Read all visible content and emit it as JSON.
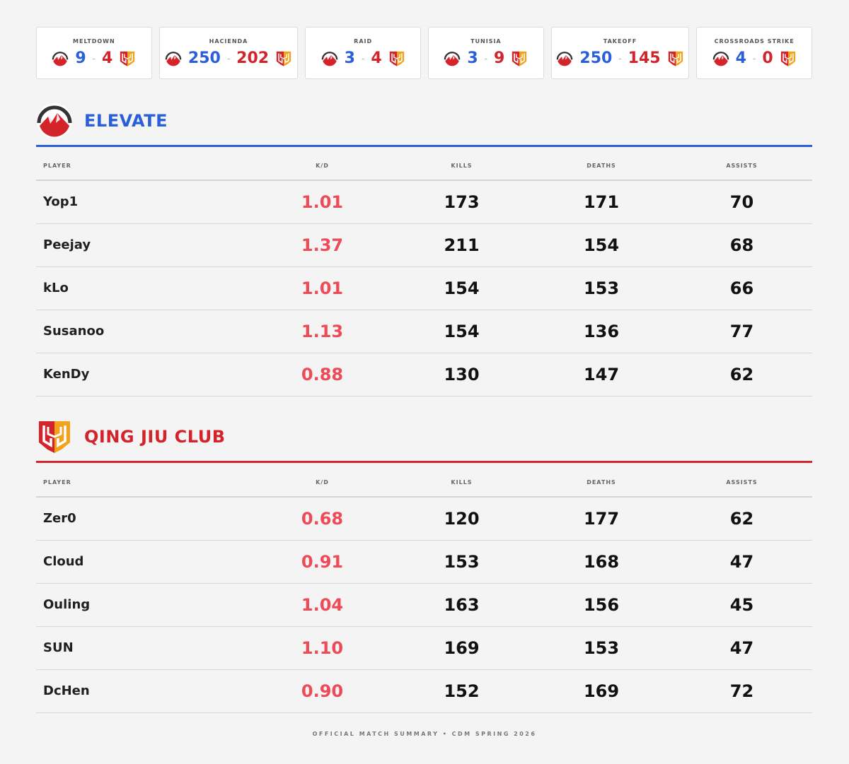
{
  "colors": {
    "team_a": "#2b5fd9",
    "team_b": "#d3242b",
    "kd": "#ec4b57"
  },
  "maps": [
    {
      "name": "MELTDOWN",
      "score_a": "9",
      "score_b": "4"
    },
    {
      "name": "HACIENDA",
      "score_a": "250",
      "score_b": "202"
    },
    {
      "name": "RAID",
      "score_a": "3",
      "score_b": "4"
    },
    {
      "name": "TUNISIA",
      "score_a": "3",
      "score_b": "9"
    },
    {
      "name": "TAKEOFF",
      "score_a": "250",
      "score_b": "145"
    },
    {
      "name": "CROSSROADS STRIKE",
      "score_a": "4",
      "score_b": "0"
    }
  ],
  "score_separator": "-",
  "columns": {
    "player": "PLAYER",
    "kd": "K/D",
    "kills": "KILLS",
    "deaths": "DEATHS",
    "assists": "ASSISTS"
  },
  "team_a": {
    "name": "ELEVATE",
    "logo_icon": "elevate-mountain-logo",
    "players": [
      {
        "name": "Yop1",
        "kd": "1.01",
        "kills": "173",
        "deaths": "171",
        "assists": "70"
      },
      {
        "name": "Peejay",
        "kd": "1.37",
        "kills": "211",
        "deaths": "154",
        "assists": "68"
      },
      {
        "name": "kLo",
        "kd": "1.01",
        "kills": "154",
        "deaths": "153",
        "assists": "66"
      },
      {
        "name": "Susanoo",
        "kd": "1.13",
        "kills": "154",
        "deaths": "136",
        "assists": "77"
      },
      {
        "name": "KenDy",
        "kd": "0.88",
        "kills": "130",
        "deaths": "147",
        "assists": "62"
      }
    ]
  },
  "team_b": {
    "name": "QING JIU CLUB",
    "logo_icon": "qing-jiu-shield-logo",
    "players": [
      {
        "name": "Zer0",
        "kd": "0.68",
        "kills": "120",
        "deaths": "177",
        "assists": "62"
      },
      {
        "name": "Cloud",
        "kd": "0.91",
        "kills": "153",
        "deaths": "168",
        "assists": "47"
      },
      {
        "name": "Ouling",
        "kd": "1.04",
        "kills": "163",
        "deaths": "156",
        "assists": "45"
      },
      {
        "name": "SUN",
        "kd": "1.10",
        "kills": "169",
        "deaths": "153",
        "assists": "47"
      },
      {
        "name": "DcHen",
        "kd": "0.90",
        "kills": "152",
        "deaths": "169",
        "assists": "72"
      }
    ]
  },
  "footer": "OFFICIAL MATCH SUMMARY • CDM SPRING 2026"
}
